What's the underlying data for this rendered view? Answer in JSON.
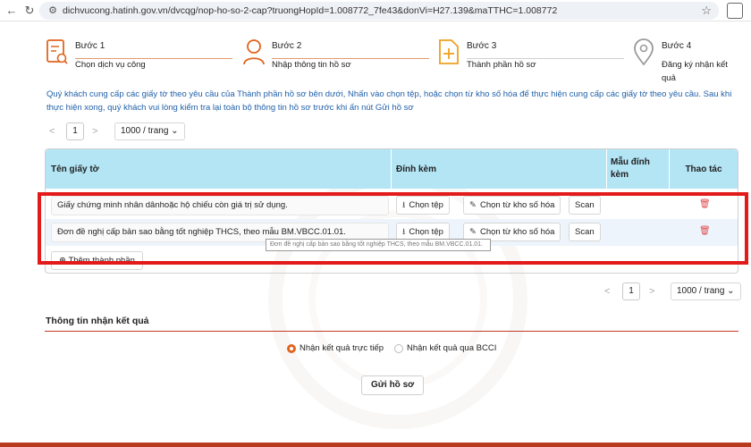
{
  "browser": {
    "url": "dichvucong.hatinh.gov.vn/dvcqg/nop-ho-so-2-cap?truongHopId=1.008772_7fe43&donVi=H27.139&maTTHC=1.008772"
  },
  "steps": [
    {
      "title": "Bước 1",
      "subtitle": "Chọn dịch vụ công",
      "icon": "document-search-icon"
    },
    {
      "title": "Bước 2",
      "subtitle": "Nhập thông tin hồ sơ",
      "icon": "user-icon"
    },
    {
      "title": "Bước 3",
      "subtitle": "Thành phần hồ sơ",
      "icon": "file-add-icon"
    },
    {
      "title": "Bước 4",
      "subtitle": "Đăng ký nhận kết quả",
      "icon": "location-pin-icon"
    }
  ],
  "note": "Quý khách cung cấp các giấy tờ theo yêu cầu của Thành phần hồ sơ bên dưới, Nhấn vào chọn tệp, hoặc chọn từ kho số hóa để thực hiện cung cấp các giấy tờ theo yêu cầu. Sau khi thực hiện xong, quý khách vui lòng kiểm tra lại toàn bộ thông tin hồ sơ trước khi ấn nút Gửi hồ sơ",
  "pager_top": {
    "prev": "<",
    "page": "1",
    "next": ">",
    "size": "1000 / trang"
  },
  "pager_bottom": {
    "prev": "<",
    "page": "1",
    "next": ">",
    "size": "1000 / trang"
  },
  "table": {
    "headers": [
      "Tên giấy tờ",
      "Đính kèm",
      "Mẫu đính kèm",
      "Thao tác"
    ],
    "rows": [
      {
        "name": "Giấy chứng minh nhân dânhoặc hộ chiếu còn giá trị sử dụng."
      },
      {
        "name": "Đơn đề nghị cấp bản sao bằng tốt nghiệp THCS, theo mẫu BM.VBCC.01.01."
      }
    ],
    "btn_choose_file": "Chọn tệp",
    "btn_choose_repo": "Chọn từ kho số hóa",
    "btn_scan": "Scan",
    "add_component": "Thêm thành phần"
  },
  "tooltip": "Đơn đề nghị cấp bản sao bằng tốt nghiệp THCS, theo mẫu BM.VBCC.01.01.",
  "result_section": {
    "title": "Thông tin nhận kết quả",
    "options": [
      {
        "label": "Nhận kết quả trực tiếp",
        "selected": true
      },
      {
        "label": "Nhận kết quả qua BCCI",
        "selected": false
      }
    ]
  },
  "submit_label": "Gửi hồ sơ",
  "colors": {
    "accent": "#e0641e",
    "table_header": "#b3e5f5",
    "highlight": "#e21a1a",
    "note": "#1f5fa8"
  }
}
